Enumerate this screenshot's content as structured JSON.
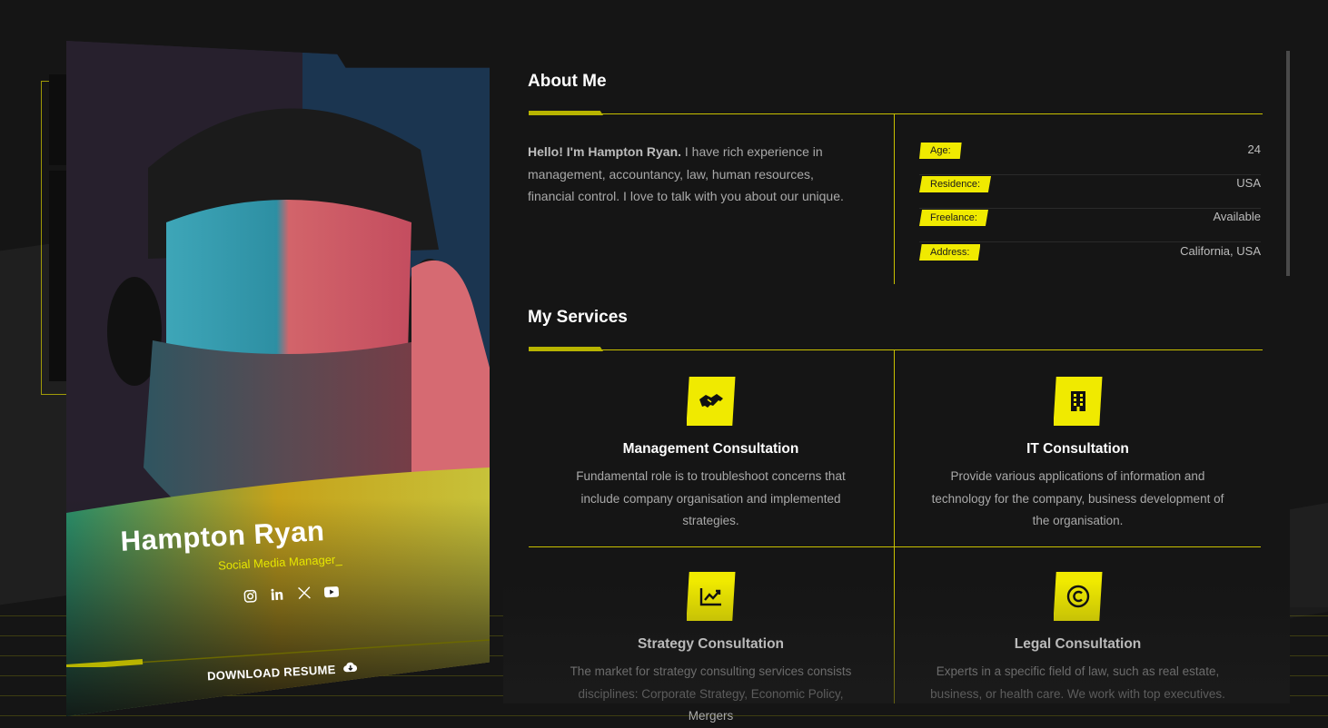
{
  "sidebar": {
    "top_icons": [
      "menu-icon",
      "sun-icon"
    ],
    "nav_icons": [
      "user-icon",
      "resume-icon",
      "folder-icon",
      "news-icon",
      "send-icon"
    ]
  },
  "profile": {
    "name": "Hampton Ryan",
    "role": "Social Media Manager_",
    "socials": [
      "instagram-icon",
      "linkedin-icon",
      "x-icon",
      "youtube-icon"
    ],
    "download_label": "DOWNLOAD RESUME"
  },
  "about": {
    "title": "About Me",
    "intro_bold": "Hello! I'm Hampton Ryan.",
    "intro_rest": " I have rich experience in management, accountancy, law, human resources, financial control. I love to talk with you about our unique.",
    "info": [
      {
        "label": "Age:",
        "value": "24"
      },
      {
        "label": "Residence:",
        "value": "USA"
      },
      {
        "label": "Freelance:",
        "value": "Available"
      },
      {
        "label": "Address:",
        "value": "California, USA"
      }
    ]
  },
  "services": {
    "title": "My Services",
    "items": [
      {
        "icon": "handshake-icon",
        "title": "Management Consultation",
        "desc": "Fundamental role is to troubleshoot concerns that include company organisation and implemented strategies."
      },
      {
        "icon": "building-icon",
        "title": "IT Consultation",
        "desc": "Provide various applications of information and technology for the company, business development of the organisation."
      },
      {
        "icon": "chart-line-icon",
        "title": "Strategy Consultation",
        "desc": "The market for strategy consulting services consists disciplines: Corporate Strategy, Economic Policy, Mergers"
      },
      {
        "icon": "copyright-icon",
        "title": "Legal Consultation",
        "desc": "Experts in a specific field of law, such as real estate, business, or health care. We work with top executives."
      }
    ]
  },
  "colors": {
    "accent": "#f0ea00",
    "background": "#151515",
    "text_muted": "#a9a9a9"
  }
}
